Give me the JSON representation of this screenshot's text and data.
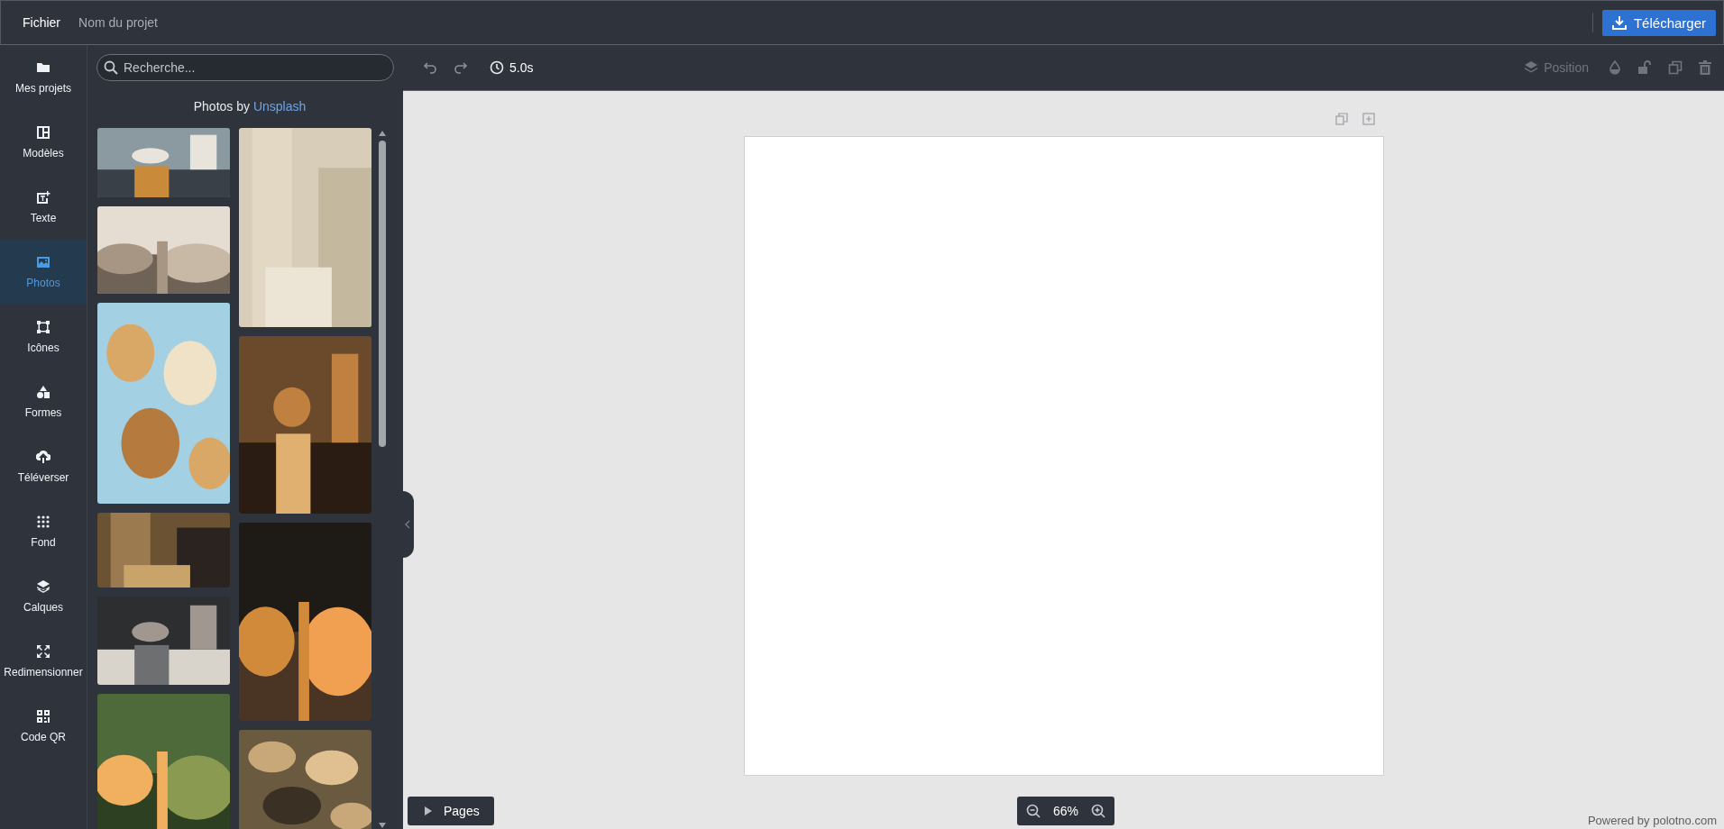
{
  "menu": {
    "file": "Fichier",
    "project_name": "Nom du projet",
    "download": "Télécharger"
  },
  "sidebar": {
    "items": [
      {
        "label": "Mes projets",
        "selected": false
      },
      {
        "label": "Modèles",
        "selected": false
      },
      {
        "label": "Texte",
        "selected": false
      },
      {
        "label": "Photos",
        "selected": true
      },
      {
        "label": "Icônes",
        "selected": false
      },
      {
        "label": "Formes",
        "selected": false
      },
      {
        "label": "Téléverser",
        "selected": false
      },
      {
        "label": "Fond",
        "selected": false
      },
      {
        "label": "Calques",
        "selected": false
      },
      {
        "label": "Redimensionner",
        "selected": false
      },
      {
        "label": "Code QR",
        "selected": false
      }
    ]
  },
  "panel": {
    "search": {
      "placeholder": "Recherche..."
    },
    "credit": "Photos by",
    "credit_link": "Unsplash"
  },
  "toolbar": {
    "duration": "5.0s",
    "position": "Position"
  },
  "footer": {
    "pages": "Pages",
    "zoom": "66%",
    "powered": "Powered by polotno.com"
  }
}
